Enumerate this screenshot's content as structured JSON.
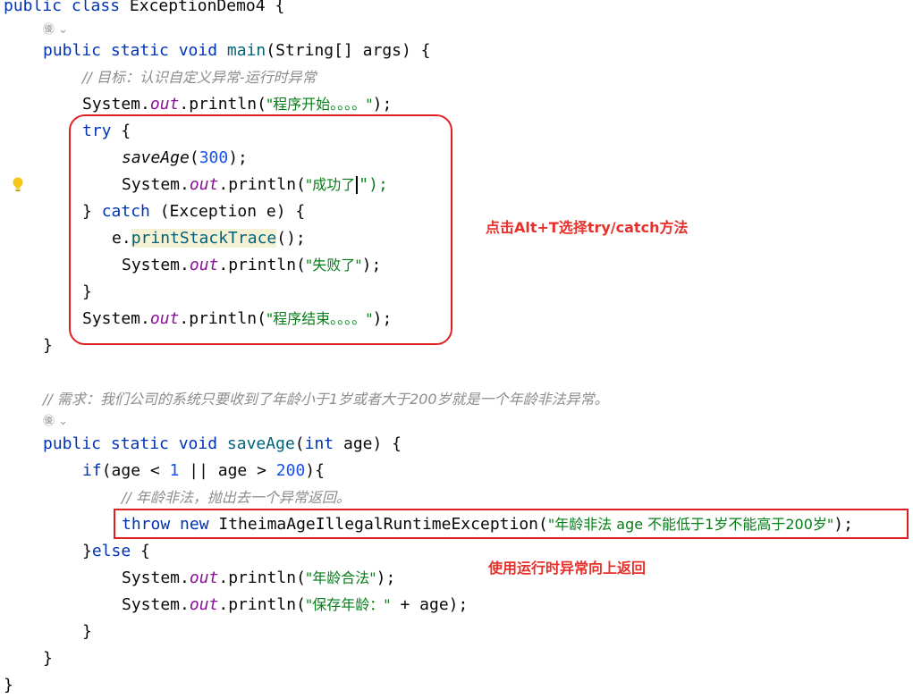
{
  "code": {
    "class_keywords": "public class",
    "class_name": "ExceptionDemo4",
    "open_brace": "{",
    "main": {
      "keywords": "public static void",
      "name": "main",
      "params": "(String[] args) {",
      "comment": "// 目标：认识自定义异常-运行时异常",
      "print_start_prefix": "System.",
      "out": "out",
      "println": ".println(",
      "print_start_str": "\"程序开始。。。。\"",
      "close_paren": ");",
      "try_kw": "try",
      "try_brace": " {",
      "save_call": "saveAge",
      "save_open": "(",
      "save_arg": "300",
      "save_close": ");",
      "print_success_str": "\"成功了",
      "print_success_end": "\");",
      "catch_open": "} ",
      "catch_kw": "catch",
      "catch_params": " (Exception e) {",
      "stack_obj": "e.",
      "stack_call": "printStackTrace",
      "stack_end": "();",
      "print_fail_str": "\"失败了\"",
      "close_try": "}",
      "print_end_str": "\"程序结束。。。。\"",
      "close_main": "}"
    },
    "requirement_comment": "// 需求：我们公司的系统只要收到了年龄小于1岁或者大于200岁就是一个年龄非法异常。",
    "save_method": {
      "keywords": "public static void",
      "name": "saveAge",
      "param_open": "(",
      "param_type": "int",
      "param_rest": " age) {",
      "if_kw": "if",
      "cond_a": "(age < ",
      "num_1": "1",
      "cond_b": " || age > ",
      "num_200": "200",
      "cond_c": "){",
      "illegal_comment": "// 年龄非法，抛出去一个异常返回。",
      "throw_kw": "throw",
      "new_kw": "new",
      "exception_class": " ItheimaAgeIllegalRuntimeException(",
      "throw_str": "\"年龄非法 age 不能低于1岁不能高于200岁\"",
      "throw_end": ");",
      "else_open": "}",
      "else_kw": "else",
      "else_brace": " {",
      "print_legal_str": "\"年龄合法\"",
      "print_save_str": "\"保存年龄：\"",
      "print_save_tail": " + age);",
      "close_else": "}",
      "close_method": "}"
    },
    "close_class": "}"
  },
  "gutter_hint": "㊝ ⌄",
  "annotations": {
    "try_catch": "点击Alt+T选择try/catch方法",
    "runtime_exception": "使用运行时异常向上返回"
  },
  "colors": {
    "keyword": "#0033b3",
    "method": "#00627a",
    "string": "#067d17",
    "number": "#1750eb",
    "field": "#871094",
    "comment": "#8c8c8c",
    "annotation_red": "#e8302a"
  }
}
